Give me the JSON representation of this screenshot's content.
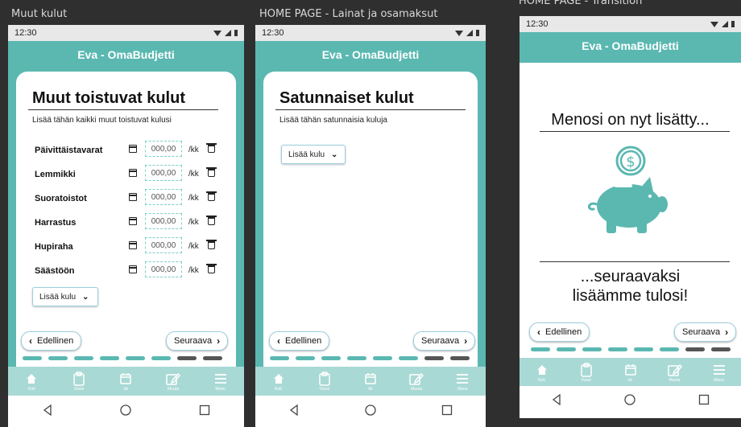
{
  "status": {
    "time": "12:30"
  },
  "app": {
    "title": "Eva - OmaBudjetti"
  },
  "frames": [
    {
      "label": "Muut kulut"
    },
    {
      "label": "HOME PAGE - Lainat ja osamaksut"
    },
    {
      "label": "HOME PAGE - Transition"
    }
  ],
  "screen1": {
    "title": "Muut toistuvat kulut",
    "subtitle": "Lisää tähän kaikki muut toistuvat kulusi",
    "rows": [
      {
        "label": "Päivittäistavarat",
        "amount_placeholder": "000,00",
        "unit": "/kk"
      },
      {
        "label": "Lemmikki",
        "amount_placeholder": "000,00",
        "unit": "/kk"
      },
      {
        "label": "Suoratoistot",
        "amount_placeholder": "000,00",
        "unit": "/kk"
      },
      {
        "label": "Harrastus",
        "amount_placeholder": "000,00",
        "unit": "/kk"
      },
      {
        "label": "Hupiraha",
        "amount_placeholder": "000,00",
        "unit": "/kk"
      },
      {
        "label": "Säästöön",
        "amount_placeholder": "000,00",
        "unit": "/kk"
      }
    ],
    "add_label": "Lisää kulu",
    "prev_label": "Edellinen",
    "next_label": "Seuraava"
  },
  "screen2": {
    "title": "Satunnaiset kulut",
    "subtitle": "Lisää tähän satunnaisia kuluja",
    "add_label": "Lisää kulu",
    "prev_label": "Edellinen",
    "next_label": "Seuraava"
  },
  "screen3": {
    "heading": "Menosi on nyt lisätty...",
    "footer_line1": "...seuraavaksi",
    "footer_line2": "lisäämme tulosi!",
    "piggy_symbol": "$",
    "prev_label": "Edellinen",
    "next_label": "Seuraava"
  },
  "progress": {
    "total_steps": 8,
    "completed_steps": 6
  },
  "tabs": [
    {
      "label": "Koti",
      "icon": "home-icon"
    },
    {
      "label": "Vuosi",
      "icon": "clipboard-icon"
    },
    {
      "label": "kk",
      "icon": "calendar-icon"
    },
    {
      "label": "Muuta",
      "icon": "edit-icon"
    },
    {
      "label": "Menu",
      "icon": "menu-icon"
    }
  ],
  "colors": {
    "teal": "#5ab8b1",
    "teal_light": "#a9d9d5",
    "background": "#2f2f2f"
  }
}
